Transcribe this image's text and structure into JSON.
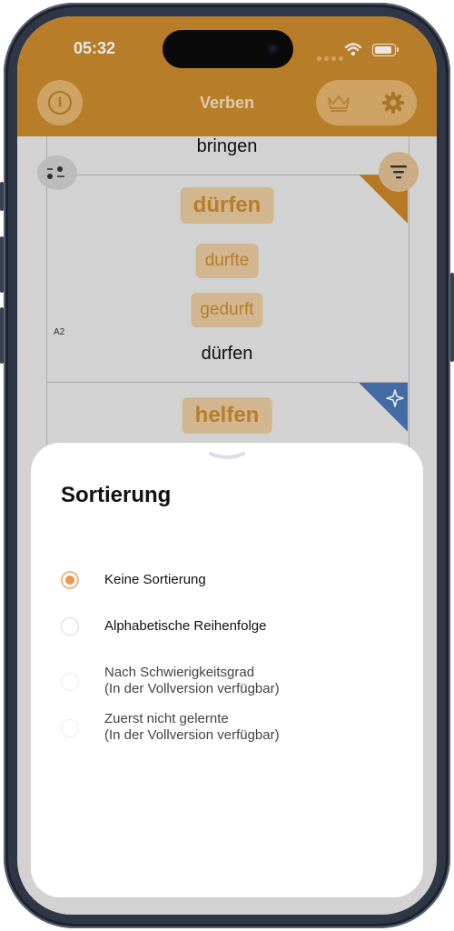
{
  "status_bar": {
    "time": "05:32"
  },
  "header": {
    "title": "Verben"
  },
  "list": {
    "prev_word": "bringen",
    "card": {
      "infinitive": "dürfen",
      "past": "durfte",
      "participle": "gedurft",
      "level": "A2",
      "word": "dürfen"
    },
    "next_card": {
      "infinitive": "helfen"
    }
  },
  "sheet": {
    "title": "Sortierung",
    "options": [
      {
        "label": "Keine Sortierung",
        "selected": true
      },
      {
        "label": "Alphabetische Reihenfolge",
        "selected": false
      },
      {
        "label": "Nach Schwierigkeitsgrad",
        "note": "(In der Vollversion verfügbar)",
        "disabled": true
      },
      {
        "label": "Zuerst nicht gelernte",
        "note": "(In der Vollversion verfügbar)",
        "disabled": true
      }
    ]
  },
  "colors": {
    "header": "#cb8a2e",
    "accent_soft": "#e3b46d",
    "radio_selected": "#f0964e",
    "corner_blue": "#4b77b5"
  }
}
